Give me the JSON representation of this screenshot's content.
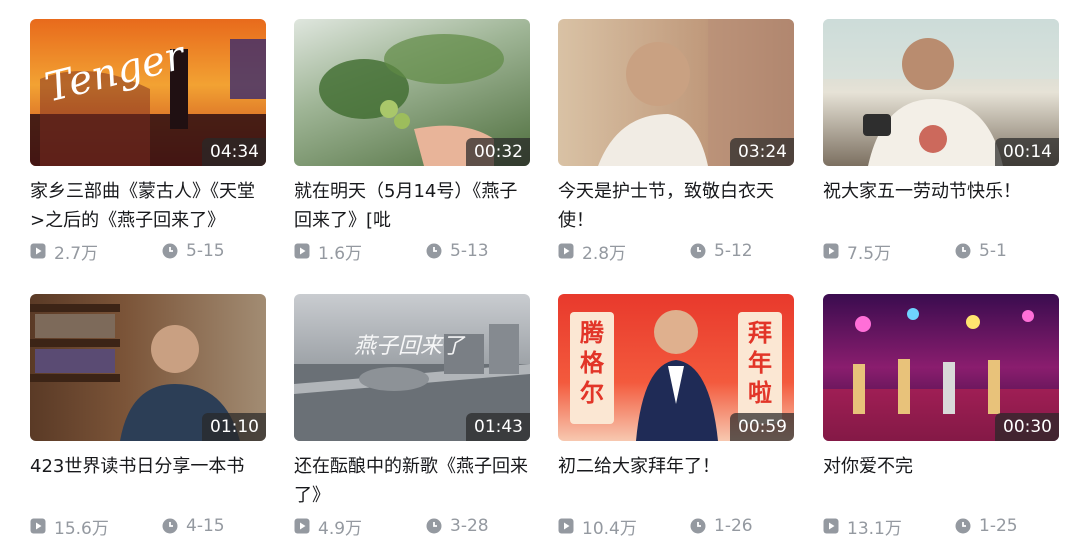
{
  "videos": [
    {
      "title": "家乡三部曲《蒙古人》《天堂>之后的《燕子回来了》",
      "duration": "04:34",
      "plays": "2.7万",
      "date": "5-15",
      "thumb_text": "Tenger"
    },
    {
      "title": "就在明天（5月14号）《燕子回来了》[吡",
      "duration": "00:32",
      "plays": "1.6万",
      "date": "5-13"
    },
    {
      "title": "今天是护士节，致敬白衣天使！",
      "duration": "03:24",
      "plays": "2.8万",
      "date": "5-12"
    },
    {
      "title": "祝大家五一劳动节快乐！",
      "duration": "00:14",
      "plays": "7.5万",
      "date": "5-1"
    },
    {
      "title": "423世界读书日分享一本书",
      "duration": "01:10",
      "plays": "15.6万",
      "date": "4-15"
    },
    {
      "title": "还在酝酿中的新歌《燕子回来了》",
      "duration": "01:43",
      "plays": "4.9万",
      "date": "3-28",
      "thumb_text": "燕子回来了"
    },
    {
      "title": "初二给大家拜年了！",
      "duration": "00:59",
      "plays": "10.4万",
      "date": "1-26",
      "thumb_text_left": "腾格尔",
      "thumb_text_right": "拜年啦"
    },
    {
      "title": "对你爱不完",
      "duration": "00:30",
      "plays": "13.1万",
      "date": "1-25"
    }
  ],
  "icons": {
    "play": "play-count-icon",
    "clock": "date-clock-icon"
  },
  "colors": {
    "meta": "#9499a0",
    "title": "#18191c",
    "duration_bg": "#282828"
  }
}
